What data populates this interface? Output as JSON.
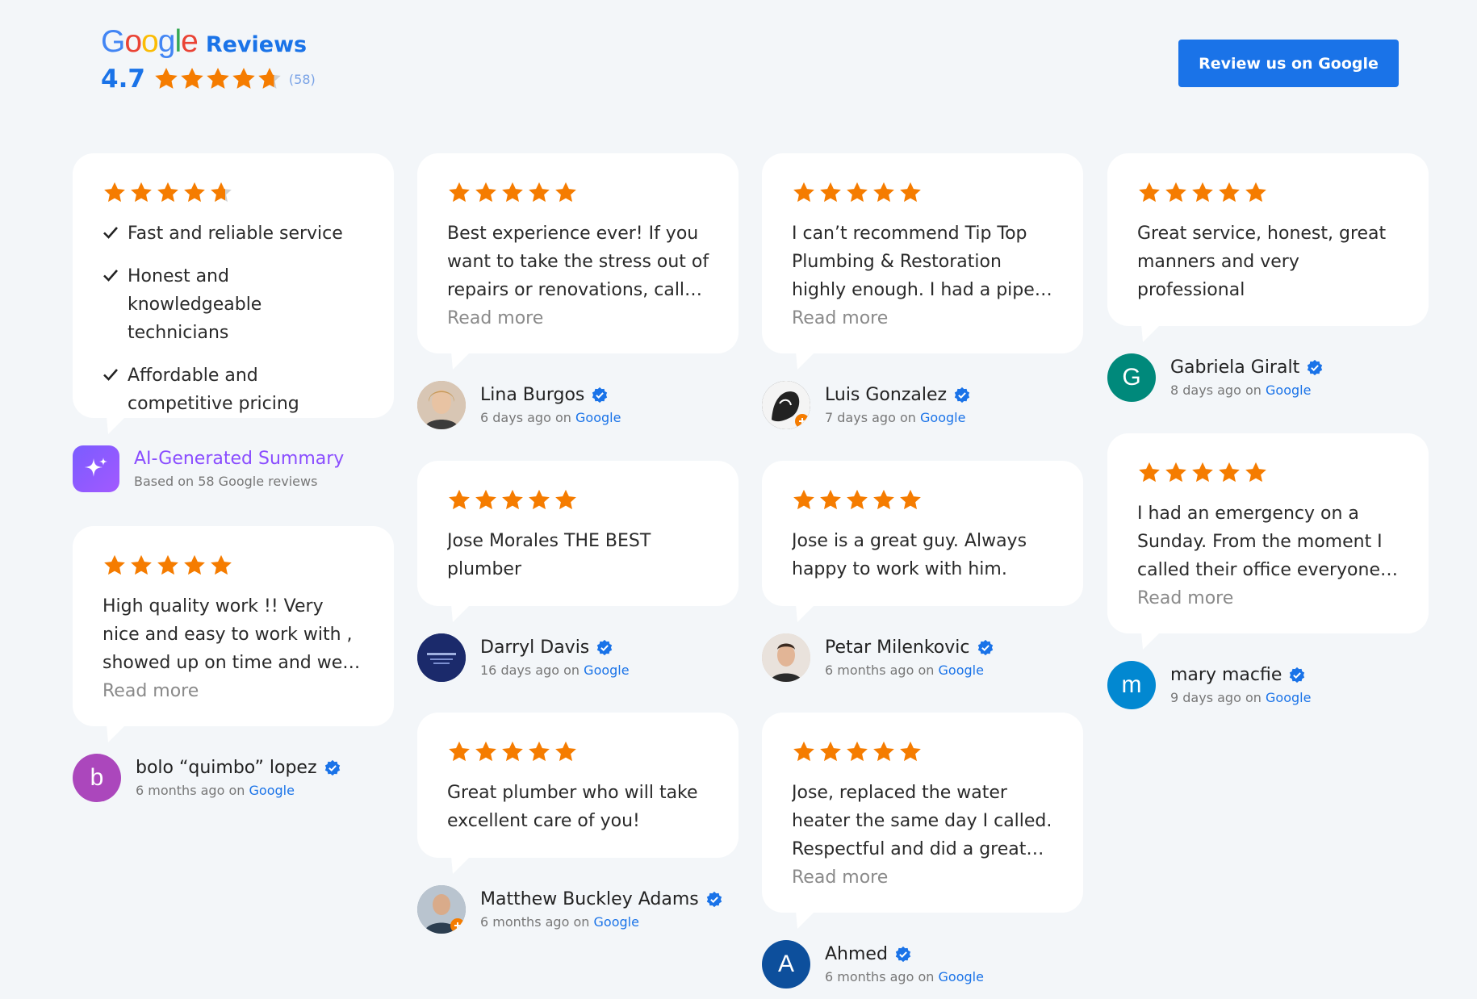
{
  "header": {
    "logo_letters": [
      "G",
      "o",
      "o",
      "g",
      "l",
      "e"
    ],
    "reviews_word": "Reviews",
    "rating": "4.7",
    "count": "(58)",
    "rating_stars": 4.7,
    "button_label": "Review us on Google"
  },
  "colors": {
    "star": "#f57c00",
    "accent": "#1a73e8",
    "verified": "#1a73e8",
    "ai_purple": "#8a4dff"
  },
  "summary": {
    "stars": 4.7,
    "items": [
      "Fast and reliable service",
      "Honest and knowledgeable technicians",
      "Affordable and competitive pricing"
    ],
    "title": "AI-Generated Summary",
    "subtitle": "Based on 58 Google reviews",
    "icon": "sparkle-icon"
  },
  "reviews": [
    {
      "text": "High quality work !! Very nice and easy to work with , showed up on time and went above and beyond.",
      "read_more": "Read more",
      "name": "bolo “quimbo” lopez",
      "when": "6 months ago",
      "on": "on",
      "source": "Google",
      "avatar_letter": "b",
      "avatar_color": "#ab47bc"
    },
    {
      "text": "Best experience ever! If you want to take the stress out of repairs or renovations, call Tip Top Plumbing & Restoration.",
      "read_more": "Read more",
      "name": "Lina Burgos",
      "when": "6 days ago",
      "on": "on",
      "source": "Google",
      "avatar_letter": "",
      "avatar_color": "#c9a27e"
    },
    {
      "text": "Jose Morales THE BEST plumber",
      "name": "Darryl Davis",
      "when": "16 days ago",
      "on": "on",
      "source": "Google",
      "avatar_letter": "",
      "avatar_color": "#1b2a6b"
    },
    {
      "text": "Great plumber who will take excellent care of you!",
      "name": "Matthew Buckley Adams",
      "when": "6 months ago",
      "on": "on",
      "source": "Google",
      "avatar_letter": "",
      "avatar_color": "#8c9aa8"
    },
    {
      "text": "I can’t recommend Tip Top Plumbing & Restoration highly enough. I had a pipe burst and they came right away.",
      "read_more": "Read more",
      "name": "Luis Gonzalez",
      "when": "7 days ago",
      "on": "on",
      "source": "Google",
      "avatar_letter": "",
      "avatar_color": "#222222"
    },
    {
      "text": "Jose is a great guy. Always happy to work with him.",
      "name": "Petar Milenkovic",
      "when": "6 months ago",
      "on": "on",
      "source": "Google",
      "avatar_letter": "",
      "avatar_color": "#d7c2b0"
    },
    {
      "text": "Jose, replaced the water heater the same day I called. Respectful and did a great job.",
      "read_more": "Read more",
      "name": "Ahmed",
      "when": "6 months ago",
      "on": "on",
      "source": "Google",
      "avatar_letter": "A",
      "avatar_color": "#0d4f9c"
    },
    {
      "text": "Great service, honest, great manners and very professional",
      "name": "Gabriela Giralt",
      "when": "8 days ago",
      "on": "on",
      "source": "Google",
      "avatar_letter": "G",
      "avatar_color": "#00897b"
    },
    {
      "text": "I had an emergency on a Sunday. From the moment I called their office everyone was helpful.",
      "read_more": "Read more",
      "name": "mary macfie",
      "when": "9 days ago",
      "on": "on",
      "source": "Google",
      "avatar_letter": "m",
      "avatar_color": "#0288d1"
    }
  ]
}
